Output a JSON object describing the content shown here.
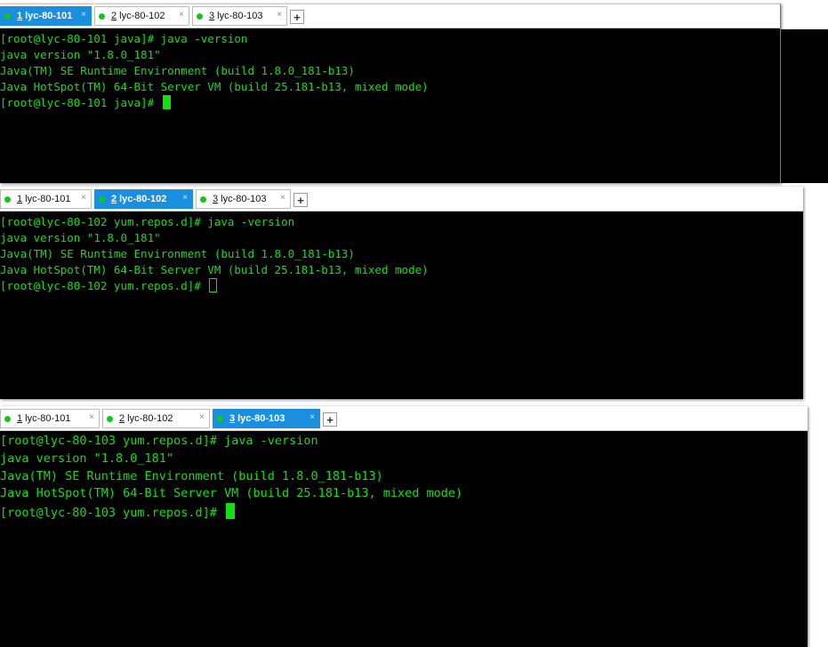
{
  "windows": [
    {
      "id": "session-1",
      "tabs": [
        {
          "num": "1",
          "label": " lyc-80-101",
          "active": true,
          "close": "×"
        },
        {
          "num": "2",
          "label": " lyc-80-102",
          "active": false,
          "close": "×"
        },
        {
          "num": "3",
          "label": " lyc-80-103",
          "active": false,
          "close": "×"
        }
      ],
      "add_tab": "+",
      "lines": [
        "[root@lyc-80-101 java]# java -version",
        "java version \"1.8.0_181\"",
        "Java(TM) SE Runtime Environment (build 1.8.0_181-b13)",
        "Java HotSpot(TM) 64-Bit Server VM (build 25.181-b13, mixed mode)"
      ],
      "prompt": "[root@lyc-80-101 java]# ",
      "cursor_focused": true
    },
    {
      "id": "session-2",
      "tabs": [
        {
          "num": "1",
          "label": " lyc-80-101",
          "active": false,
          "close": "×"
        },
        {
          "num": "2",
          "label": " lyc-80-102",
          "active": true,
          "close": "×"
        },
        {
          "num": "3",
          "label": " lyc-80-103",
          "active": false,
          "close": "×"
        }
      ],
      "add_tab": "+",
      "lines": [
        "[root@lyc-80-102 yum.repos.d]# java -version",
        "java version \"1.8.0_181\"",
        "Java(TM) SE Runtime Environment (build 1.8.0_181-b13)",
        "Java HotSpot(TM) 64-Bit Server VM (build 25.181-b13, mixed mode)"
      ],
      "prompt": "[root@lyc-80-102 yum.repos.d]# ",
      "cursor_focused": false
    },
    {
      "id": "session-3",
      "tabs": [
        {
          "num": "1",
          "label": " lyc-80-101",
          "active": false,
          "close": "×"
        },
        {
          "num": "2",
          "label": " lyc-80-102",
          "active": false,
          "close": "×"
        },
        {
          "num": "3",
          "label": " lyc-80-103",
          "active": true,
          "close": "×"
        }
      ],
      "add_tab": "+",
      "lines": [
        "[root@lyc-80-103 yum.repos.d]# java -version",
        "java version \"1.8.0_181\"",
        "Java(TM) SE Runtime Environment (build 1.8.0_181-b13)",
        "Java HotSpot(TM) 64-Bit Server VM (build 25.181-b13, mixed mode)"
      ],
      "prompt": "[root@lyc-80-103 yum.repos.d]# ",
      "cursor_focused": true
    }
  ],
  "colors": {
    "terminal_bg": "#000000",
    "terminal_text": "#13e013",
    "active_tab": "#1a8fe0",
    "status_dot": "#12c61a"
  }
}
